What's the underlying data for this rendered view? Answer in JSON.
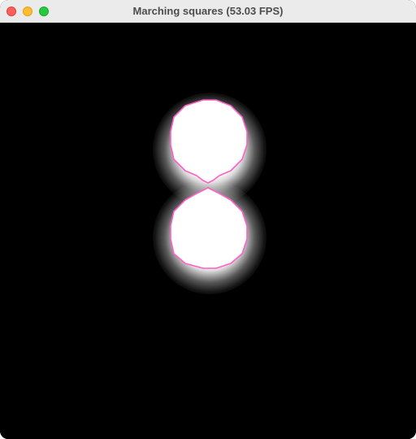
{
  "window": {
    "title": "Marching squares (53.03 FPS)",
    "buttons": [
      {
        "name": "close",
        "color": "#fe5f57",
        "border": "#e0443e"
      },
      {
        "name": "minimize",
        "color": "#febc2e",
        "border": "#dea123"
      },
      {
        "name": "zoom",
        "color": "#28c840",
        "border": "#1aab29"
      }
    ]
  },
  "scene": {
    "background": "#000000",
    "blob_fill": "#ffffff",
    "contour_color": "#ff5fc8",
    "blob_count": 2
  }
}
